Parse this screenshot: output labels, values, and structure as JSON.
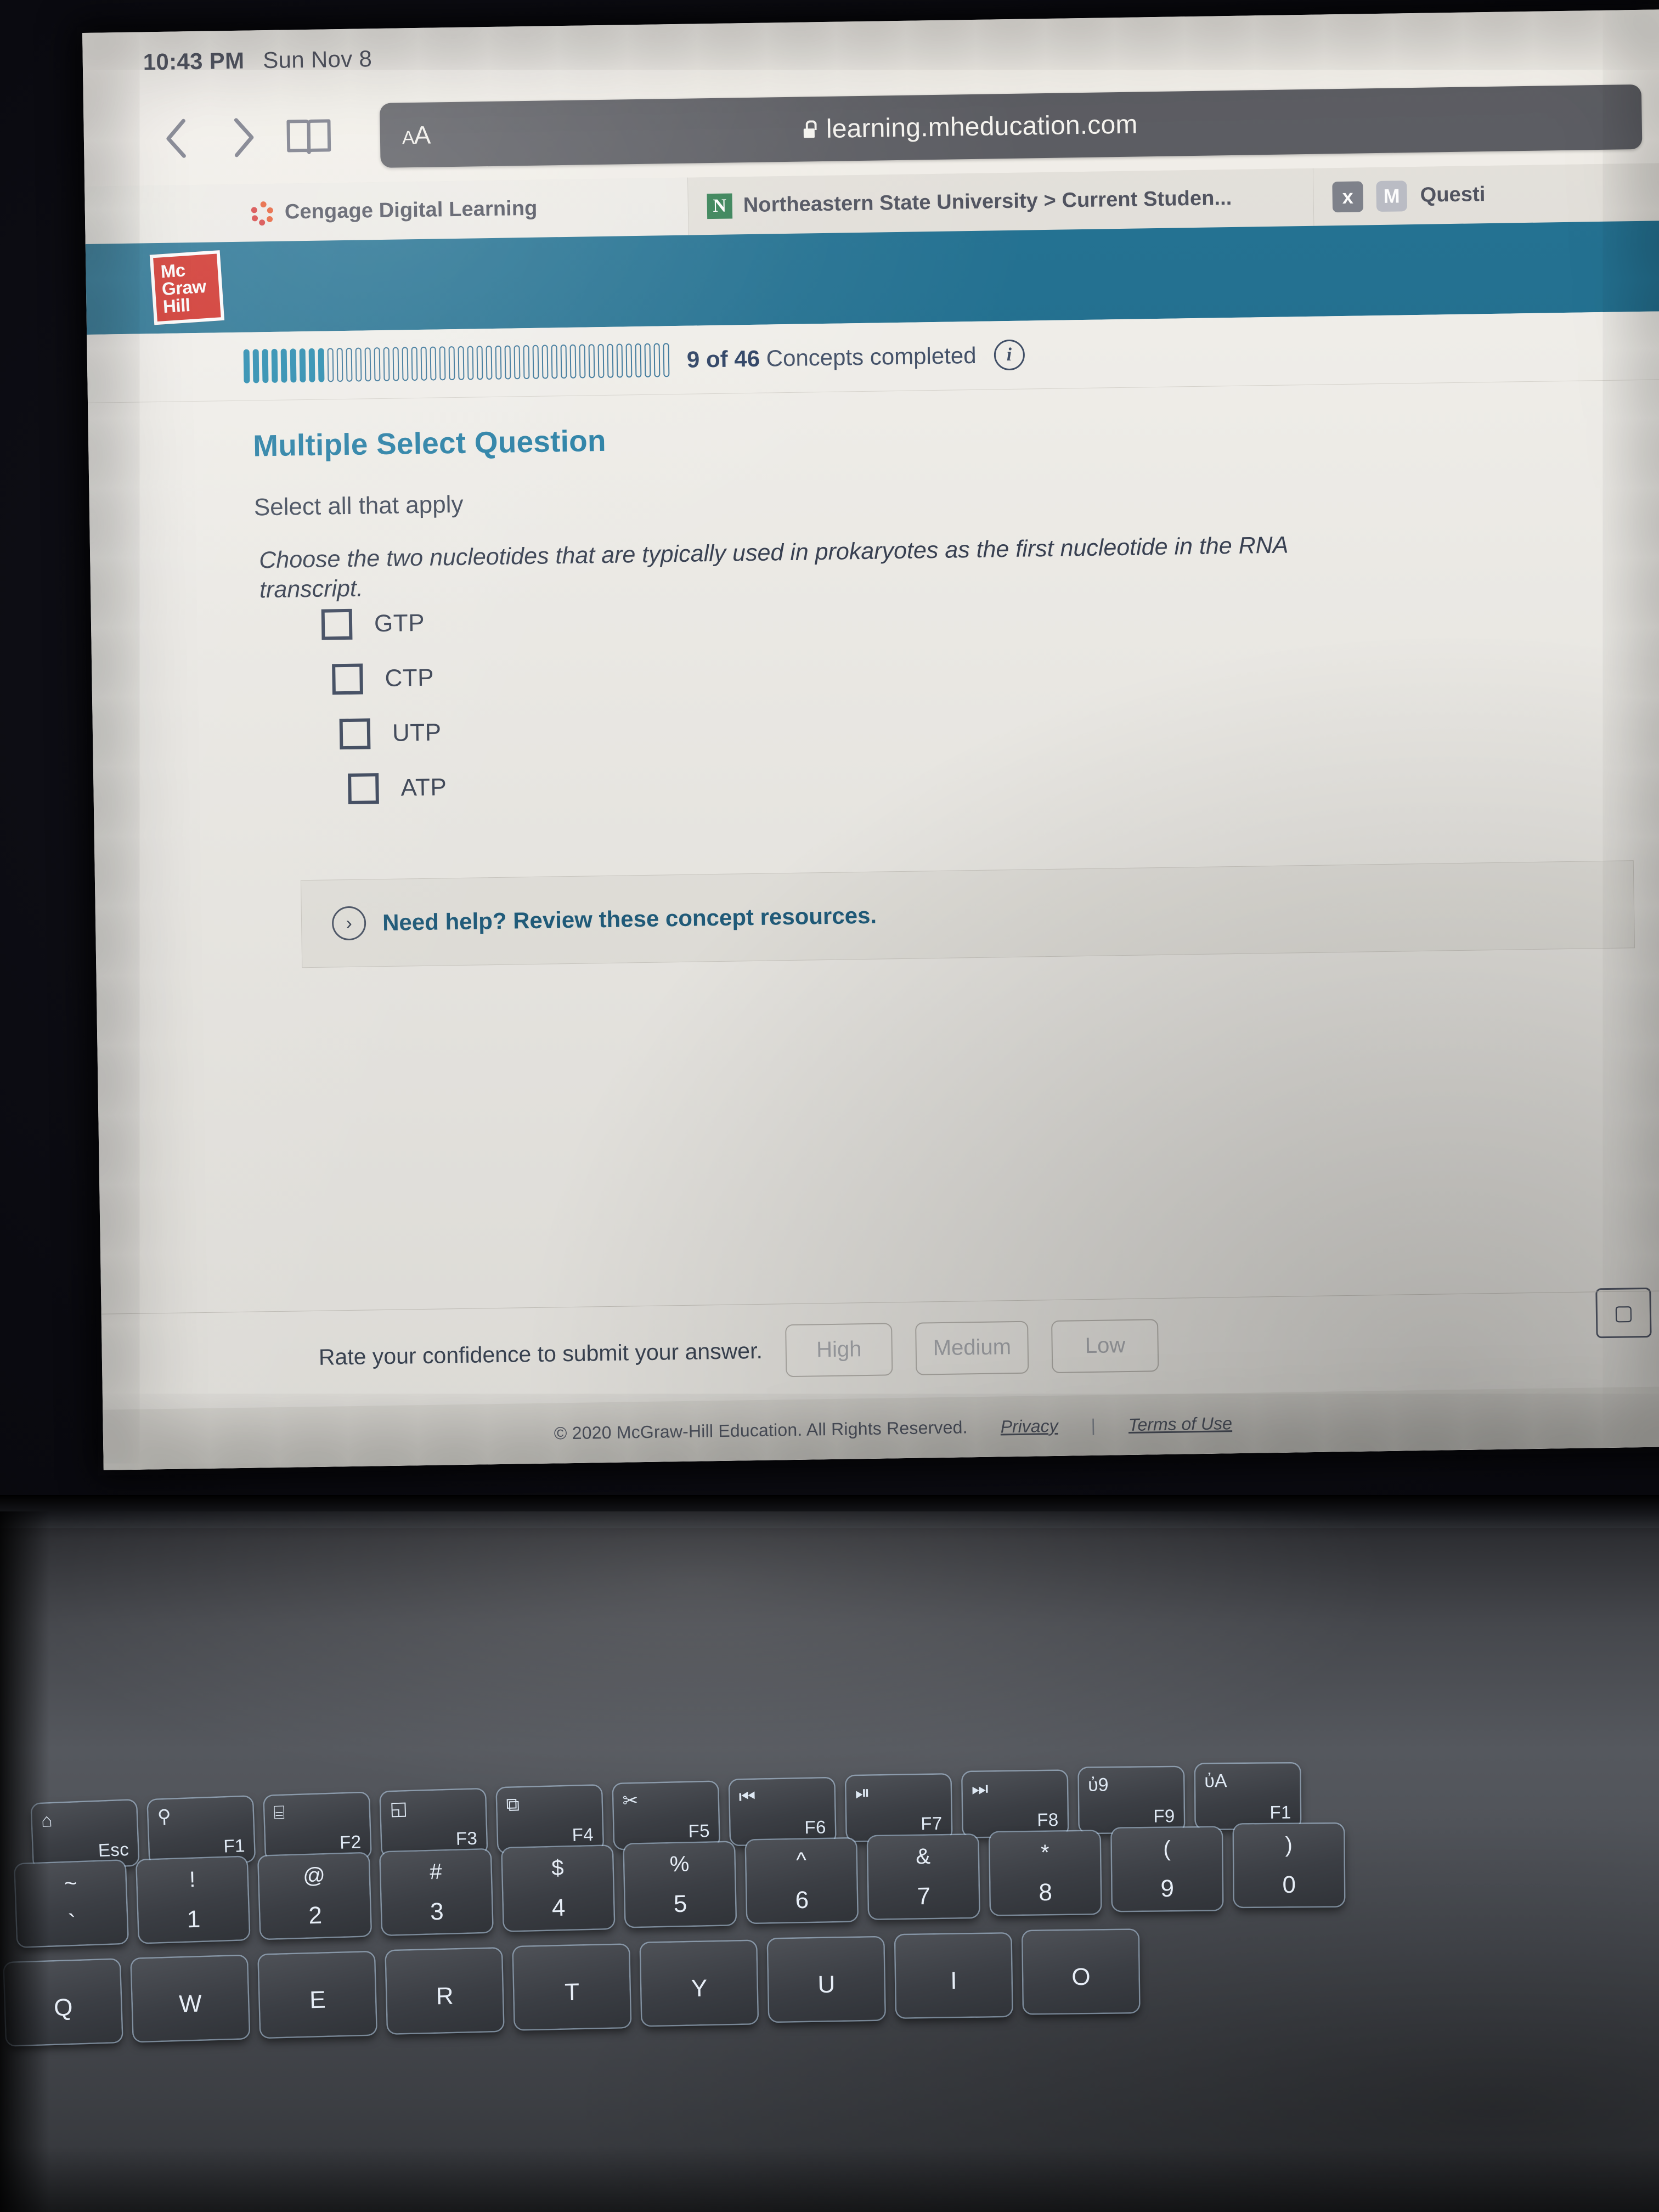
{
  "device": {
    "status_bar": {
      "time": "10:43 PM",
      "date": "Sun Nov 8"
    }
  },
  "browser": {
    "back_icon": "chevron-left-icon",
    "forward_icon": "chevron-right-icon",
    "bookmarks_icon": "book-icon",
    "reader_tools_label": "AA",
    "url": "learning.mheducation.com",
    "lock_icon": "lock-icon",
    "tabs": [
      {
        "favicon": "cengage-icon",
        "label": "Cengage Digital Learning"
      },
      {
        "favicon": "northeastern-n-icon",
        "label": "Northeastern State University > Current Studen..."
      },
      {
        "close_label": "x",
        "favicon": "mcgraw-m-icon",
        "label": "Questi"
      }
    ]
  },
  "app": {
    "brand": {
      "line1": "Mc",
      "line2": "Graw",
      "line3": "Hill",
      "color": "#d0251d",
      "header_color": "#1b6d8f"
    },
    "progress": {
      "completed": 9,
      "total": 46,
      "count_label": "9 of 46",
      "caption": "Concepts completed",
      "info_icon": "info-circle-icon",
      "accent_color": "#1a86ad"
    },
    "question": {
      "type_label": "Multiple Select Question",
      "instruction": "Select all that apply",
      "prompt": "Choose the two nucleotides that are typically used in prokaryotes as the first nucleotide in the RNA transcript.",
      "options": [
        {
          "label": "GTP",
          "checked": false
        },
        {
          "label": "CTP",
          "checked": false
        },
        {
          "label": "UTP",
          "checked": false
        },
        {
          "label": "ATP",
          "checked": false
        }
      ]
    },
    "help": {
      "expand_icon": "chevron-right-circle-icon",
      "text": "Need help? Review these concept resources."
    },
    "confidence": {
      "label": "Rate your confidence to submit your answer.",
      "buttons": [
        "High",
        "Medium",
        "Low"
      ]
    },
    "bookmark_icon": "bookmark-icon",
    "footer": {
      "legal": "© 2020 McGraw-Hill Education. All Rights Reserved.",
      "privacy": "Privacy",
      "separator": "|",
      "terms": "Terms of Use"
    }
  },
  "keyboard": {
    "function_row": [
      {
        "glyph": "⌂",
        "label": "Esc"
      },
      {
        "glyph": "search-icon",
        "label": "F1"
      },
      {
        "glyph": "keyboard-light-icon",
        "label": "F2"
      },
      {
        "glyph": "task-view-icon",
        "label": "F3"
      },
      {
        "glyph": "screen-switch-icon",
        "label": "F4"
      },
      {
        "glyph": "scissors-icon",
        "label": "F5"
      },
      {
        "glyph": "prev-track-icon",
        "label": "F6"
      },
      {
        "glyph": "play-pause-icon",
        "label": "F7"
      },
      {
        "glyph": "next-track-icon",
        "label": "F8"
      },
      {
        "glyph": "volume-down-icon",
        "label": "F9"
      },
      {
        "glyph": "volume-up-icon",
        "label": "F1"
      }
    ],
    "number_row": [
      {
        "top": "~",
        "bottom": "`"
      },
      {
        "top": "!",
        "bottom": "1"
      },
      {
        "top": "@",
        "bottom": "2"
      },
      {
        "top": "#",
        "bottom": "3"
      },
      {
        "top": "$",
        "bottom": "4"
      },
      {
        "top": "%",
        "bottom": "5"
      },
      {
        "top": "^",
        "bottom": "6"
      },
      {
        "top": "&",
        "bottom": "7"
      },
      {
        "top": "*",
        "bottom": "8"
      },
      {
        "top": "(",
        "bottom": "9"
      },
      {
        "top": ")",
        "bottom": "0"
      }
    ],
    "letter_row": [
      "Q",
      "W",
      "E",
      "R",
      "T",
      "Y",
      "U",
      "I",
      "O"
    ]
  }
}
